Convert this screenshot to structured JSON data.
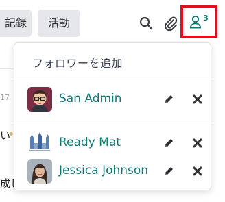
{
  "tabs": {
    "log_label": "記録",
    "activity_label": "活動"
  },
  "followers": {
    "count": "3",
    "add_follower_label": "フォロワーを追加",
    "items": [
      {
        "name": "San Admin",
        "avatar": "user-avatar-man-glasses"
      },
      {
        "name": "Ready Mat",
        "avatar": "company-logo-ready-mat"
      },
      {
        "name": "Jessica Johnson",
        "avatar": "user-avatar-woman"
      }
    ]
  },
  "background": {
    "date_fragment": "17",
    "snippet_1": "い",
    "snippet_2": "成し"
  },
  "colors": {
    "link": "#0e7a76",
    "highlight_border": "#e0101f",
    "tab_bg": "#e6e7ea"
  }
}
